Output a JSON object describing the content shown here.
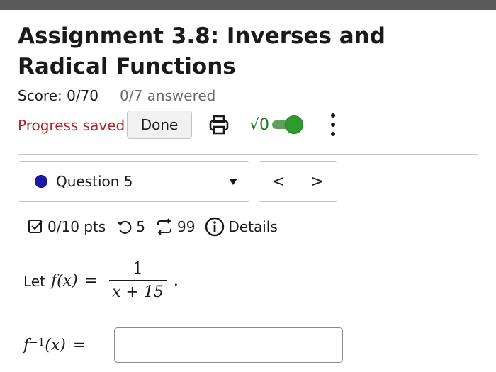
{
  "header": {
    "title": "Assignment 3.8: Inverses and Radical Functions",
    "score": "Score: 0/70",
    "answered": "0/7 answered",
    "progress": "Progress saved",
    "done_label": "Done"
  },
  "toolbar": {
    "sqrt_symbol": "√0",
    "math_toggle_on": true,
    "icons": [
      "print-icon",
      "sqrt-icon",
      "toggle-switch",
      "more-options-icon"
    ]
  },
  "question_nav": {
    "selected": "Question 5",
    "prev": "<",
    "next": ">"
  },
  "meta": {
    "points": "0/10 pts",
    "attempts": "5",
    "versions": "99",
    "details": "Details"
  },
  "question": {
    "prompt": "Let",
    "func": "f(x)",
    "equals": "=",
    "numerator": "1",
    "denominator": "x + 15",
    "period": ".",
    "answer_label": "f",
    "answer_sup": "−1",
    "answer_arg": "(x)",
    "answer_equals": "=",
    "answer_value": ""
  },
  "colors": {
    "progress_saved": "#b3262a",
    "toggle_on": "#2e9b2e",
    "question_dot": "#1a1aa8"
  }
}
